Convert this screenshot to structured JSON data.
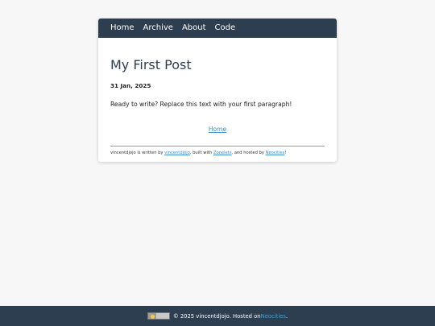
{
  "nav": {
    "items": [
      "Home",
      "Archive",
      "About",
      "Code"
    ]
  },
  "post": {
    "title": "My First Post",
    "date": "31 Jan, 2025",
    "body": "Ready to write? Replace this text with your first paragraph!",
    "home_link": "Home"
  },
  "credits": {
    "prefix": "vincentdjojo is written by ",
    "author": "vincentdjojo",
    "mid1": ", built with ",
    "builder": "Zonelets",
    "mid2": ", and hosted by ",
    "host": "Neocities",
    "suffix": "!"
  },
  "footer": {
    "badge_icon": "creative-commons-badge",
    "text": "© 2025 vincentdjojo. Hosted on ",
    "host_link": "Neocities",
    "end": "."
  },
  "colors": {
    "nav_bg": "#2c3e50",
    "link": "#3a8fd0",
    "page_bg": "#f7f7f8"
  }
}
